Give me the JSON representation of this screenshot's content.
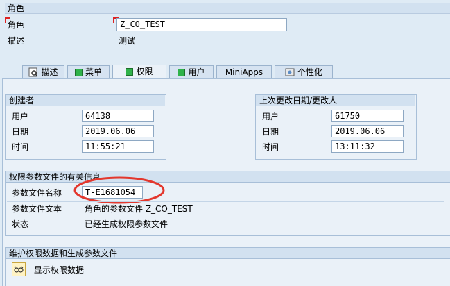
{
  "role_header": {
    "title": "角色",
    "role_label": "角色",
    "role_value": "Z_CO_TEST",
    "desc_label": "描述",
    "desc_value": "测试"
  },
  "tabs": [
    {
      "label": "描述",
      "icon": "description-icon"
    },
    {
      "label": "菜单",
      "icon": "green-square-icon"
    },
    {
      "label": "权限",
      "icon": "green-square-icon"
    },
    {
      "label": "用户",
      "icon": "green-square-icon"
    },
    {
      "label": "MiniApps",
      "icon": ""
    },
    {
      "label": "个性化",
      "icon": "personalize-icon"
    }
  ],
  "created": {
    "title": "创建者",
    "user_label": "用户",
    "user_value": "64138",
    "date_label": "日期",
    "date_value": "2019.06.06",
    "time_label": "时间",
    "time_value": "11:55:21"
  },
  "changed": {
    "title": "上次更改日期/更改人",
    "user_label": "用户",
    "user_value": "61750",
    "date_label": "日期",
    "date_value": "2019.06.06",
    "time_label": "时间",
    "time_value": "13:11:32"
  },
  "profile_info": {
    "title": "权限参数文件的有关信息",
    "name_label": "参数文件名称",
    "name_value": "T-E1681054",
    "text_label": "参数文件文本",
    "text_value": "角色的参数文件 Z_CO_TEST",
    "status_label": "状态",
    "status_value": "已经生成权限参数文件"
  },
  "maintain": {
    "title": "维护权限数据和生成参数文件",
    "display_label": "显示权限数据"
  },
  "colors": {
    "highlight_circle": "#e3372d",
    "tab_green": "#2fb24a"
  }
}
